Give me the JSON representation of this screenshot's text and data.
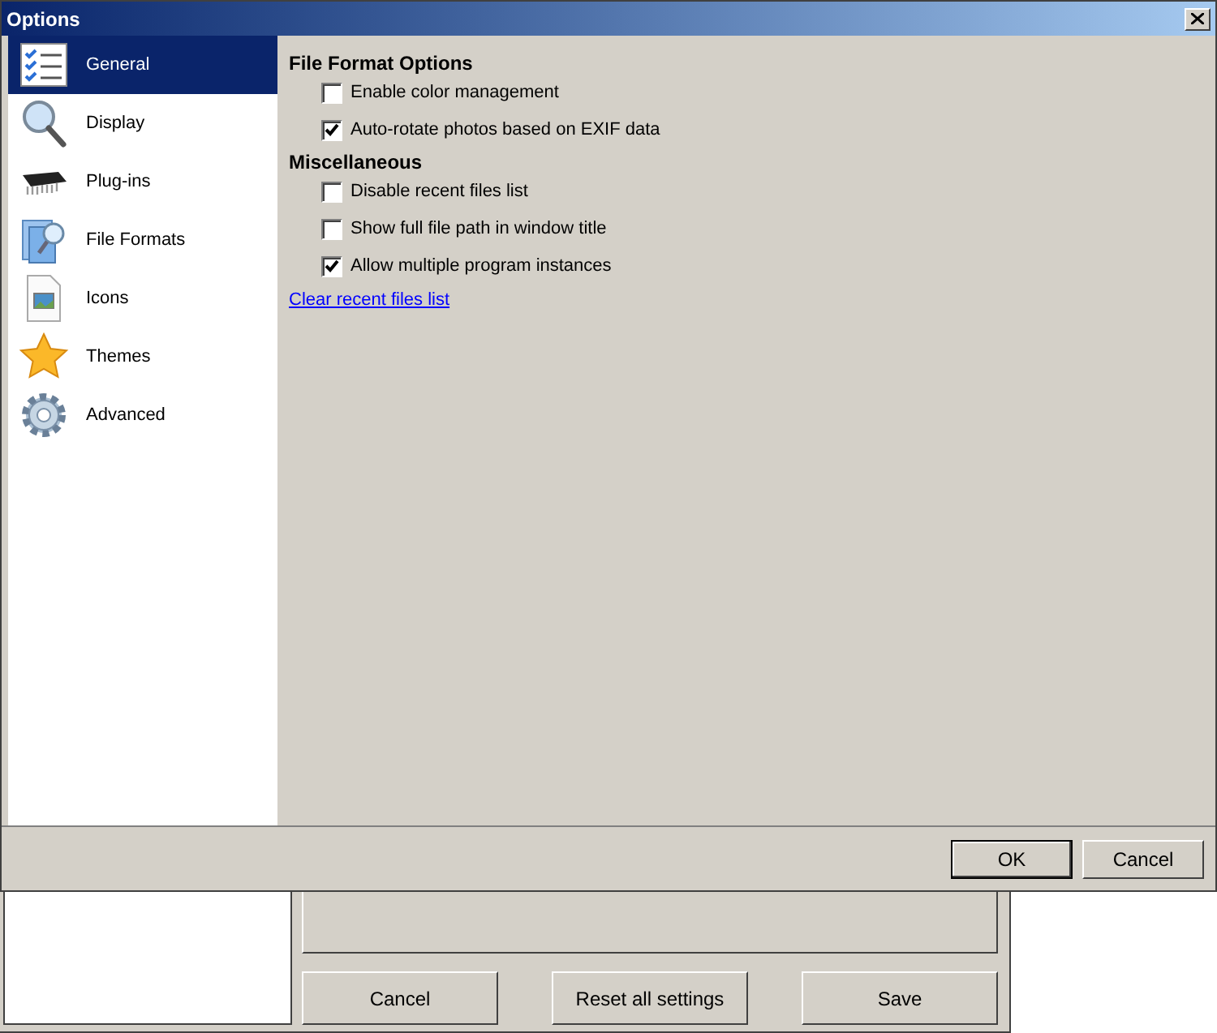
{
  "window": {
    "title": "Options"
  },
  "sidebar": {
    "items": [
      {
        "label": "General",
        "kind": "checklist",
        "selected": true
      },
      {
        "label": "Display",
        "kind": "magnifier",
        "selected": false
      },
      {
        "label": "Plug-ins",
        "kind": "chip",
        "selected": false
      },
      {
        "label": "File Formats",
        "kind": "files",
        "selected": false
      },
      {
        "label": "Icons",
        "kind": "image",
        "selected": false
      },
      {
        "label": "Themes",
        "kind": "star",
        "selected": false
      },
      {
        "label": "Advanced",
        "kind": "gear",
        "selected": false
      }
    ]
  },
  "sections": [
    {
      "heading": "File Format Options",
      "options": [
        {
          "label": "Enable color management",
          "checked": false
        },
        {
          "label": "Auto-rotate photos based on EXIF data",
          "checked": true
        }
      ]
    },
    {
      "heading": "Miscellaneous",
      "options": [
        {
          "label": "Disable recent files list",
          "checked": false
        },
        {
          "label": "Show full file path in window title",
          "checked": false
        },
        {
          "label": "Allow multiple program instances",
          "checked": true
        }
      ]
    }
  ],
  "link": "Clear recent files list",
  "buttons": [
    {
      "label": "OK",
      "default": true
    },
    {
      "label": "Cancel",
      "default": false
    }
  ],
  "background_window": {
    "buttons": [
      "Cancel",
      "Reset all settings",
      "Save"
    ]
  }
}
